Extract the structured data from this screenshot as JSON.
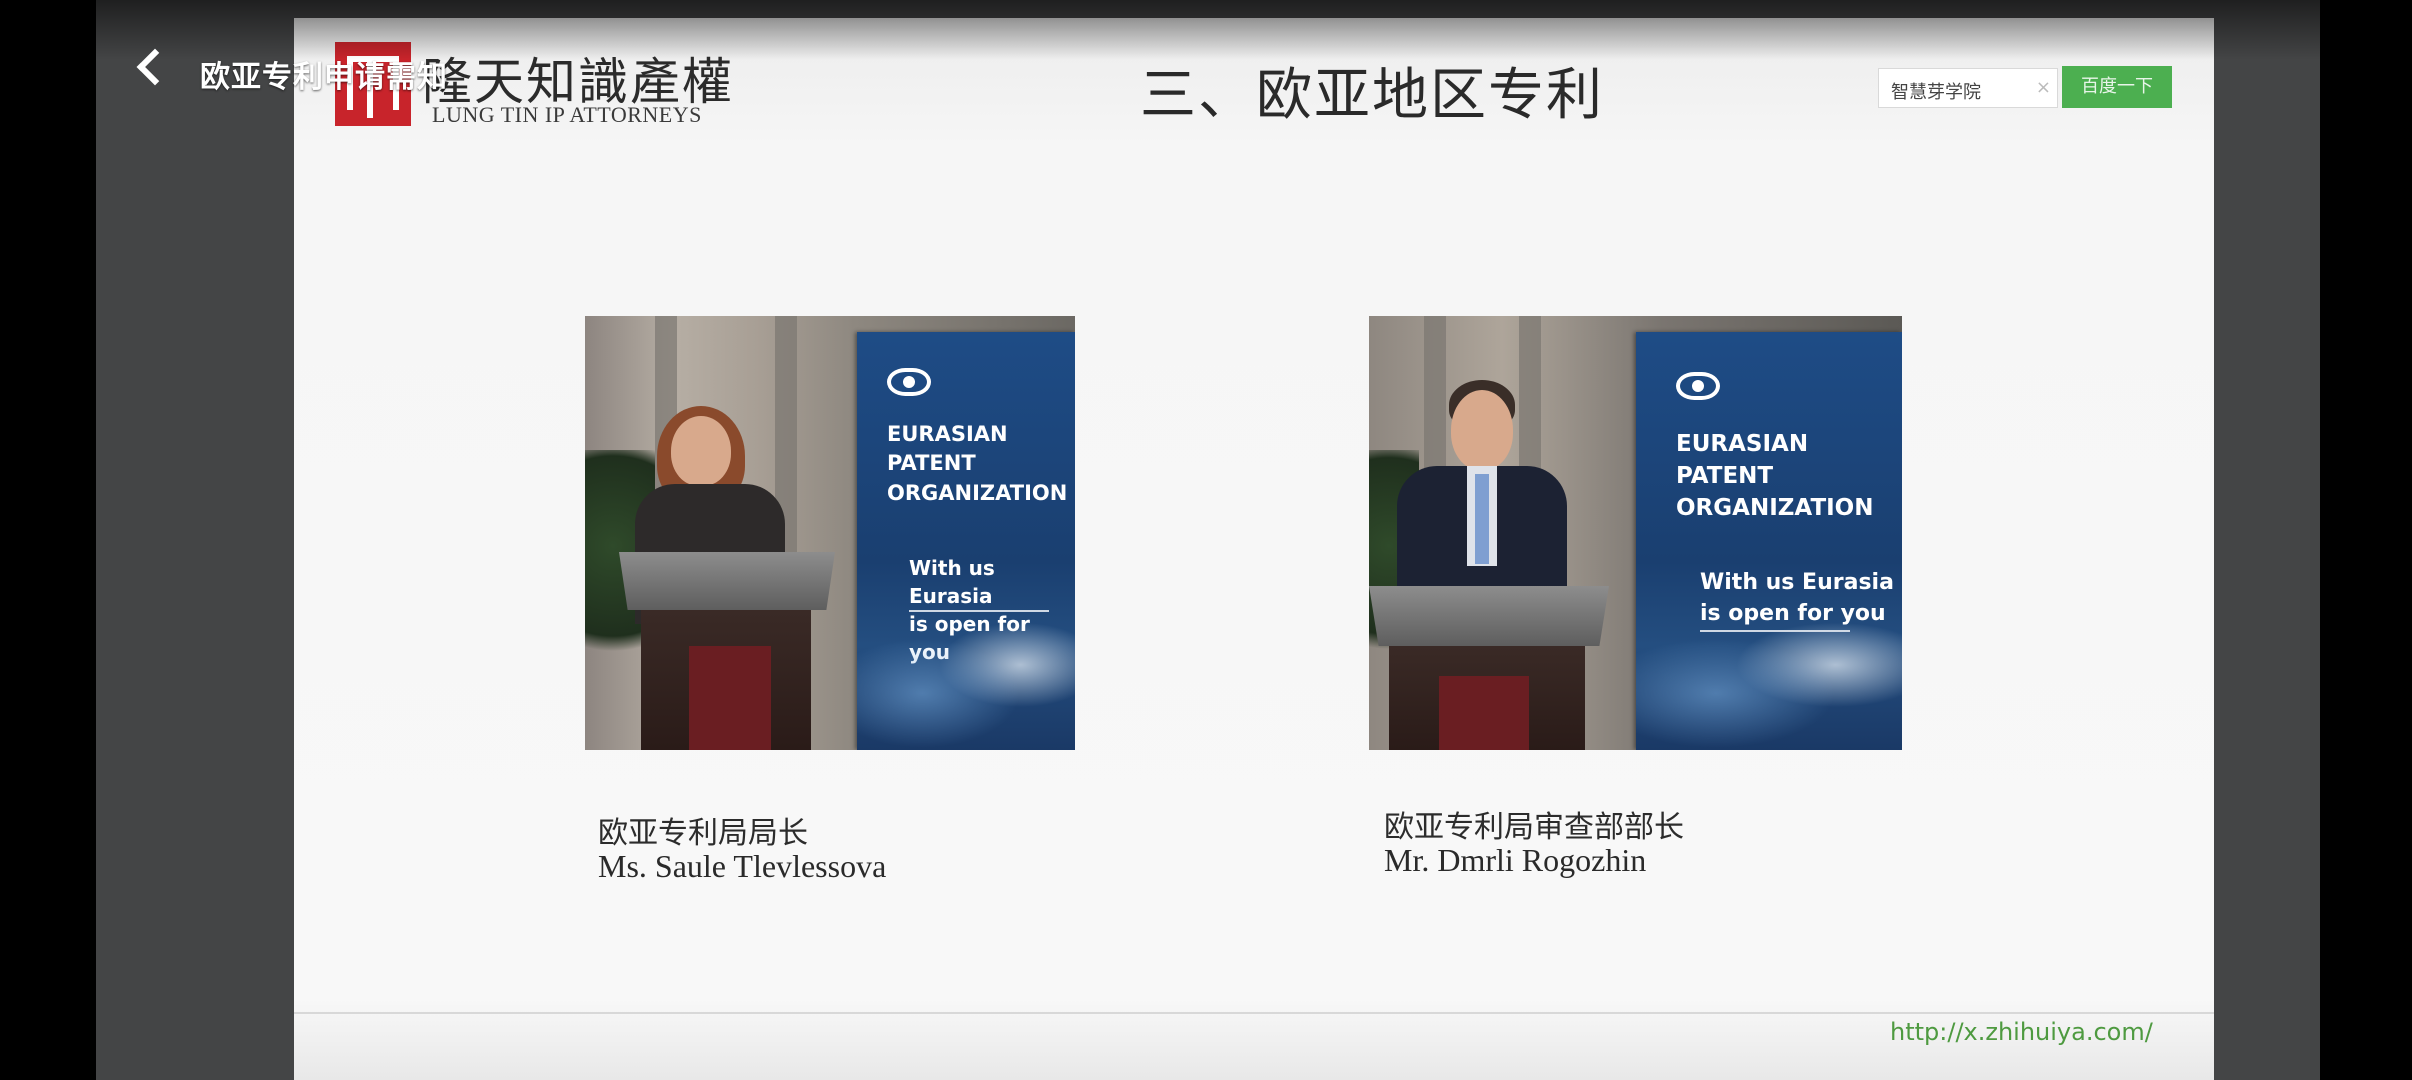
{
  "overlay": {
    "page_title": "欧亚专利申请需知"
  },
  "slide": {
    "logo_cn": "隆天知識產權",
    "logo_en": "LUNG TIN IP ATTORNEYS",
    "title": "三、欧亚地区专利",
    "footer_url": "http://x.zhihuiya.com/"
  },
  "search_widget": {
    "value": "智慧芽学院",
    "clear_icon": "×",
    "button_label": "百度一下"
  },
  "photos": [
    {
      "banner_line1": "EURASIAN\nPATENT\nORGANIZATION",
      "banner_line2": "With us Eurasia\nis open for you",
      "caption_cn": "欧亚专利局局长",
      "caption_en": "Ms. Saule Tlevlessova"
    },
    {
      "banner_line1": "EURASIAN\nPATENT\nORGANIZATION",
      "banner_line2": "With us Eurasia\nis open for you",
      "caption_cn": "欧亚专利局审查部部长",
      "caption_en": "Mr. Dmrli Rogozhin"
    }
  ],
  "colors": {
    "brand_red": "#c8242b",
    "banner_blue": "#1e4c86",
    "search_green": "#4caf50",
    "url_green": "#4e9a40"
  }
}
